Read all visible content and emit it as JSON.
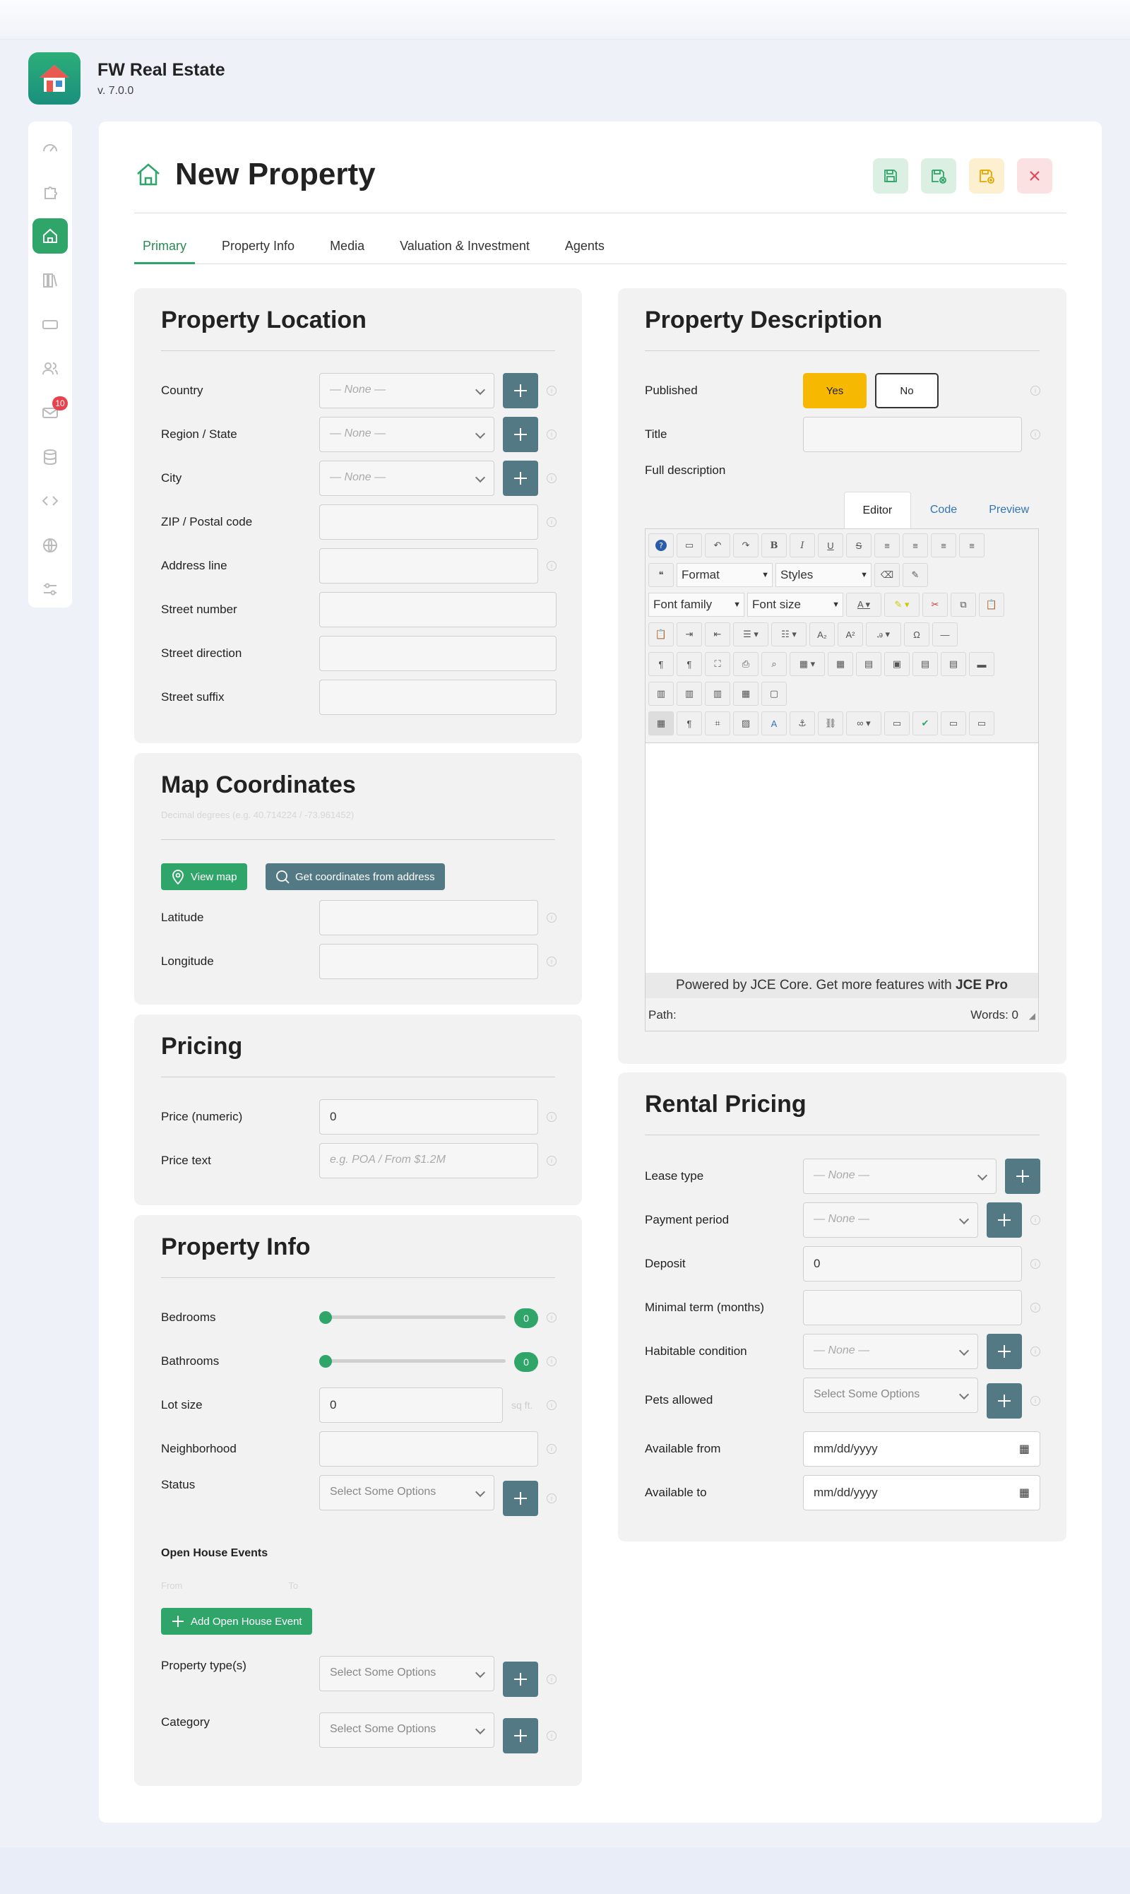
{
  "app": {
    "name": "FW Real Estate",
    "version": "v. 7.0.0"
  },
  "sidebar": {
    "badge": "10",
    "items": [
      "dashboard-icon",
      "puzzle-icon",
      "home-icon",
      "library-icon",
      "ticket-icon",
      "users-icon",
      "mail-icon",
      "database-icon",
      "code-icon",
      "globe-icon",
      "sliders-icon"
    ]
  },
  "page": {
    "title": "New Property"
  },
  "tabs": [
    "Primary",
    "Property Info",
    "Media",
    "Valuation & Investment",
    "Agents"
  ],
  "location": {
    "title": "Property Location",
    "country": "Country",
    "region": "Region / State",
    "city": "City",
    "zip": "ZIP / Postal code",
    "address": "Address line",
    "street_number": "Street number",
    "street_direction": "Street direction",
    "street_suffix": "Street suffix",
    "none": "— None —"
  },
  "map": {
    "title": "Map Coordinates",
    "subtitle": "Decimal degrees (e.g. 40.714224 / -73.961452)",
    "view_map": "View map",
    "get_coords": "Get coordinates from address",
    "latitude": "Latitude",
    "longitude": "Longitude"
  },
  "pricing": {
    "title": "Pricing",
    "price_numeric": "Price (numeric)",
    "price_value": "0",
    "price_text": "Price text",
    "price_text_placeholder": "e.g. POA / From $1.2M"
  },
  "info": {
    "title": "Property Info",
    "bedrooms": "Bedrooms",
    "bedrooms_value": "0",
    "bathrooms": "Bathrooms",
    "bathrooms_value": "0",
    "lot_size": "Lot size",
    "lot_value": "0",
    "lot_unit": "sq ft.",
    "neighborhood": "Neighborhood",
    "status": "Status",
    "select_some": "Select Some Options",
    "open_house": "Open House Events",
    "from": "From",
    "to": "To",
    "add_event": "Add Open House Event",
    "property_types": "Property type(s)",
    "category": "Category"
  },
  "description": {
    "title": "Property Description",
    "published": "Published",
    "yes": "Yes",
    "no": "No",
    "title_label": "Title",
    "full_description": "Full description",
    "editor_tabs": [
      "Editor",
      "Code",
      "Preview"
    ],
    "format": "Format",
    "styles": "Styles",
    "font_family": "Font family",
    "font_size": "Font size",
    "footer_text": "Powered by JCE Core. Get more features with ",
    "footer_bold": "JCE Pro",
    "path": "Path:",
    "words": "Words: 0"
  },
  "rental": {
    "title": "Rental Pricing",
    "lease_type": "Lease type",
    "payment_period": "Payment period",
    "deposit": "Deposit",
    "deposit_value": "0",
    "minimal_term": "Minimal term (months)",
    "habitable": "Habitable condition",
    "pets": "Pets allowed",
    "available_from": "Available from",
    "available_to": "Available to",
    "date_placeholder": "mm/dd/yyyy",
    "none": "— None —",
    "select_some": "Select Some Options"
  }
}
